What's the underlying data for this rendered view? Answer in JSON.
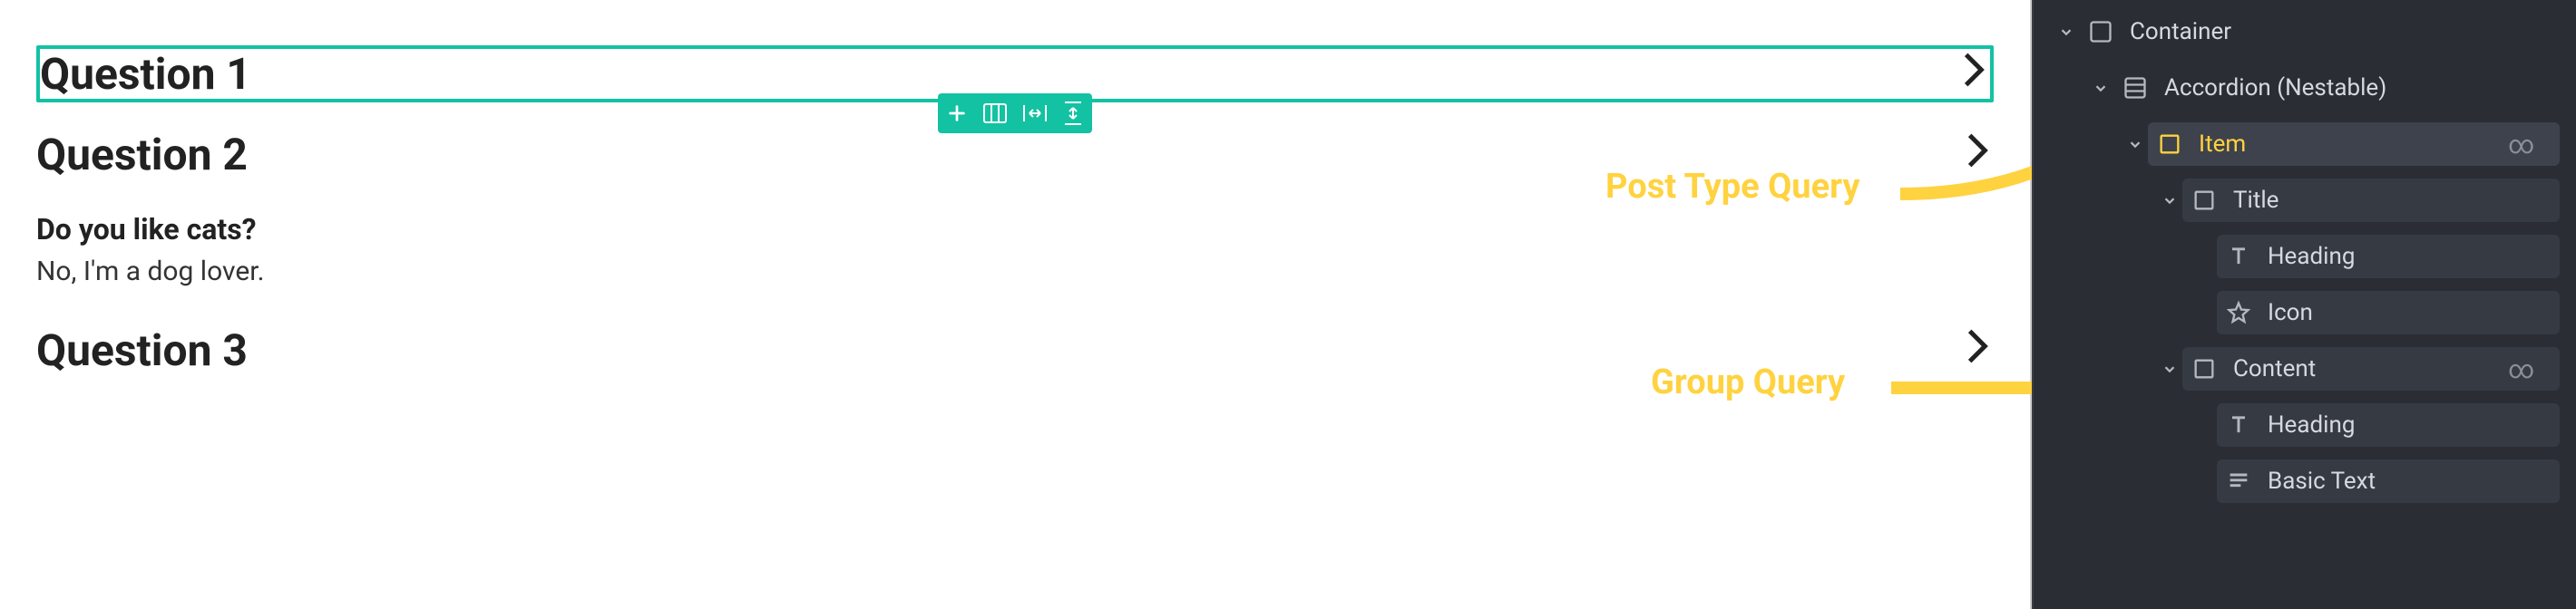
{
  "canvas": {
    "questions": [
      {
        "title": "Question 1",
        "selected": true,
        "expanded": false
      },
      {
        "title": "Question 2",
        "selected": false,
        "expanded": true,
        "expand_title": "Do you like cats?",
        "expand_body": "No, I'm a dog lover."
      },
      {
        "title": "Question 3",
        "selected": false,
        "expanded": false
      }
    ]
  },
  "annotations": {
    "post_type_query": "Post Type Query",
    "group_query": "Group Query"
  },
  "structure_panel": {
    "items": [
      {
        "depth": 0,
        "label": "Container",
        "icon": "container",
        "carat": "down",
        "bg": false,
        "sel": false,
        "loop": false
      },
      {
        "depth": 1,
        "label": "Accordion (Nestable)",
        "icon": "accordion",
        "carat": "down",
        "bg": false,
        "sel": false,
        "loop": false
      },
      {
        "depth": 2,
        "label": "Item",
        "icon": "block",
        "carat": "down",
        "bg": true,
        "sel": true,
        "loop": true
      },
      {
        "depth": 3,
        "label": "Title",
        "icon": "block",
        "carat": "down",
        "bg": true,
        "sel": false,
        "loop": false
      },
      {
        "depth": 4,
        "label": "Heading",
        "icon": "text",
        "carat": "",
        "bg": true,
        "sel": false,
        "loop": false
      },
      {
        "depth": 4,
        "label": "Icon",
        "icon": "star",
        "carat": "",
        "bg": true,
        "sel": false,
        "loop": false
      },
      {
        "depth": 3,
        "label": "Content",
        "icon": "block",
        "carat": "down",
        "bg": true,
        "sel": false,
        "loop": true
      },
      {
        "depth": 4,
        "label": "Heading",
        "icon": "text",
        "carat": "",
        "bg": true,
        "sel": false,
        "loop": false
      },
      {
        "depth": 4,
        "label": "Basic Text",
        "icon": "paragraph",
        "carat": "",
        "bg": true,
        "sel": false,
        "loop": false
      }
    ]
  },
  "colors": {
    "teal": "#13c2a3",
    "highlight": "#ffd23f",
    "panel_bg": "#2a2d33"
  }
}
